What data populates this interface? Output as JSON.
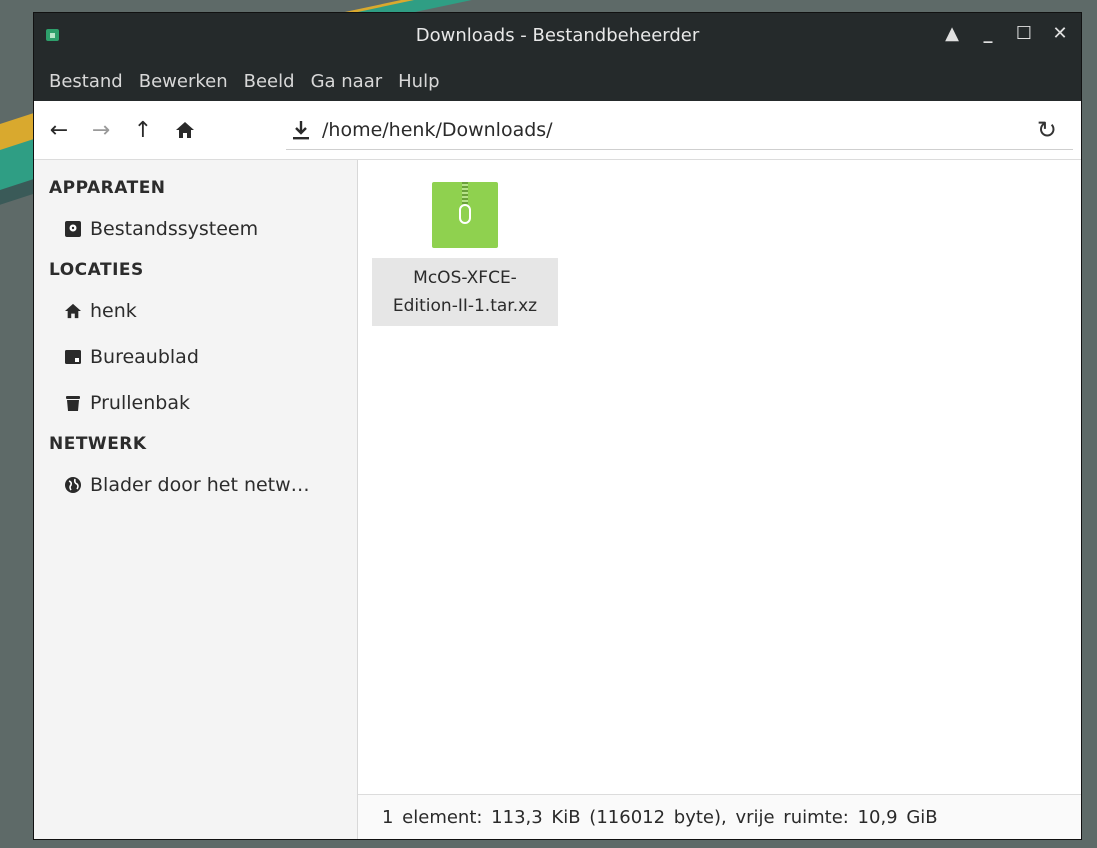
{
  "window": {
    "title": "Downloads - Bestandbeheerder",
    "controls": {
      "shade": "▲",
      "minimize": "_",
      "maximize": "☐",
      "close": "✕"
    }
  },
  "menubar": [
    "Bestand",
    "Bewerken",
    "Beeld",
    "Ga naar",
    "Hulp"
  ],
  "toolbar": {
    "back_icon": "←",
    "forward_icon": "→",
    "up_icon": "↑",
    "home_icon": "home-icon",
    "location_icon": "download-icon",
    "path": "/home/henk/Downloads/",
    "reload_icon": "↻"
  },
  "sidebar": {
    "sections": [
      {
        "header": "APPARATEN",
        "items": [
          {
            "label": "Bestandssysteem",
            "icon": "disk-icon"
          }
        ]
      },
      {
        "header": "LOCATIES",
        "items": [
          {
            "label": "henk",
            "icon": "home-icon"
          },
          {
            "label": "Bureaublad",
            "icon": "desktop-icon"
          },
          {
            "label": "Prullenbak",
            "icon": "trash-icon"
          }
        ]
      },
      {
        "header": "NETWERK",
        "items": [
          {
            "label": "Blader door het netw…",
            "icon": "globe-icon"
          }
        ]
      }
    ]
  },
  "files": [
    {
      "name_line1": "McOS-XFCE-",
      "name_line2": "Edition-II-1.tar.xz",
      "icon": "archive-icon",
      "icon_color": "#8fd14f"
    }
  ],
  "status": "1 element: 113,3 KiB (116012 byte), vrije ruimte: 10,9 GiB"
}
